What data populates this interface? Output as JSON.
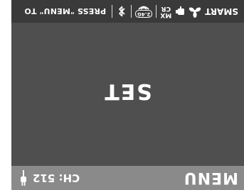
{
  "header": {
    "menu_label": "MENU",
    "channel_text": "CH: 512"
  },
  "main": {
    "set_label": "SET"
  },
  "status_bar": {
    "smart_label": "SMART",
    "crmx_label_top": "MX",
    "crmx_label_bottom": "CR",
    "frequency_badge": "2.4G",
    "hint_text": "PRESS \"MENU\" TO"
  }
}
